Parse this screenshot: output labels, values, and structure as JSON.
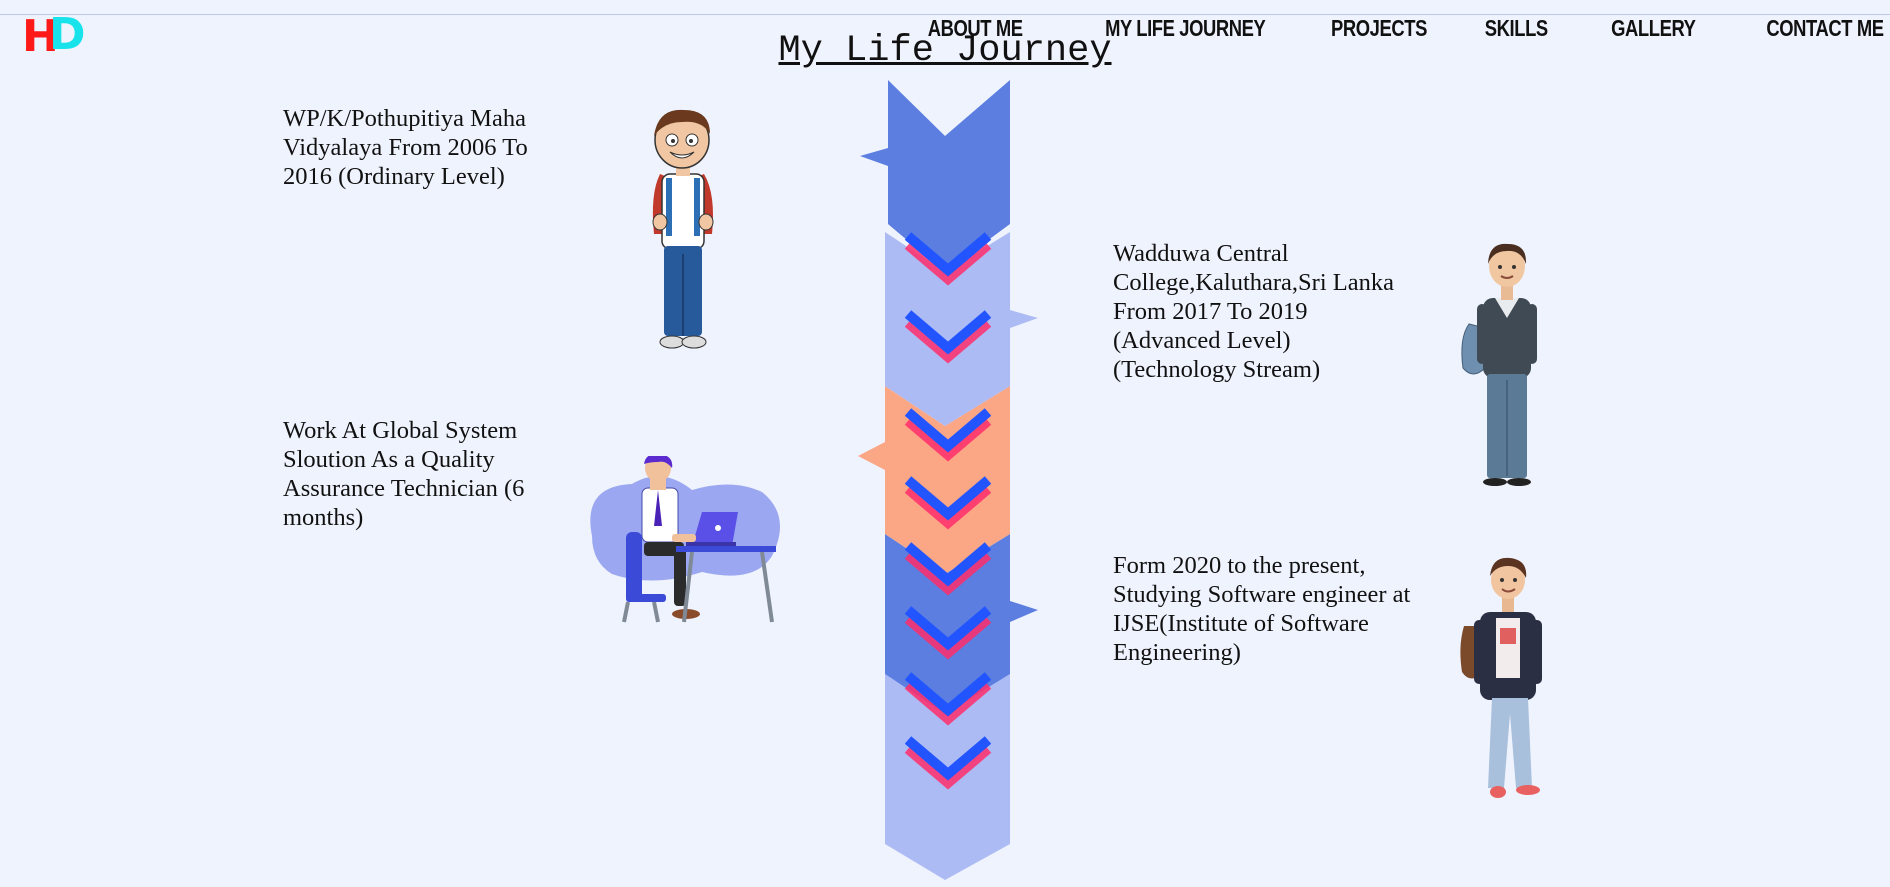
{
  "logo": {
    "letter_h": "H",
    "letter_d": "D"
  },
  "nav": [
    {
      "label": "ABOUT ME"
    },
    {
      "label": "MY LIFE JOURNEY"
    },
    {
      "label": "PROJECTS"
    },
    {
      "label": "SKILLS"
    },
    {
      "label": "GALLERY"
    },
    {
      "label": "CONTACT ME"
    }
  ],
  "page": {
    "title": "My Life Journey"
  },
  "timeline": {
    "entries": [
      {
        "text": "WP/K/Pothupitiya Maha Vidyalaya From 2006 To 2016 (Ordinary Level)",
        "illustration": "schoolboy-with-backpack"
      },
      {
        "text": "Wadduwa Central College,Kaluthara,Sri Lanka From 2017 To 2019 (Advanced Level) (Technology Stream)",
        "illustration": "teen-student-with-bag"
      },
      {
        "text": "Work At Global System Sloution As a Quality Assurance Technician (6 months)",
        "illustration": "person-at-laptop-desk"
      },
      {
        "text": "Form 2020 to the present, Studying Software engineer at IJSE(Institute of Software Engineering)",
        "illustration": "young-man-with-backpack"
      }
    ]
  },
  "colors": {
    "background": "#eff3fd",
    "logo_h": "#ff1a1a",
    "logo_d": "#19e3ea",
    "arrow_blue": "#5b7ee0",
    "arrow_light": "#adbbf5",
    "arrow_orange": "#fba786",
    "chevron_blue": "#2255ff",
    "chevron_pink": "#ff2d6b"
  }
}
